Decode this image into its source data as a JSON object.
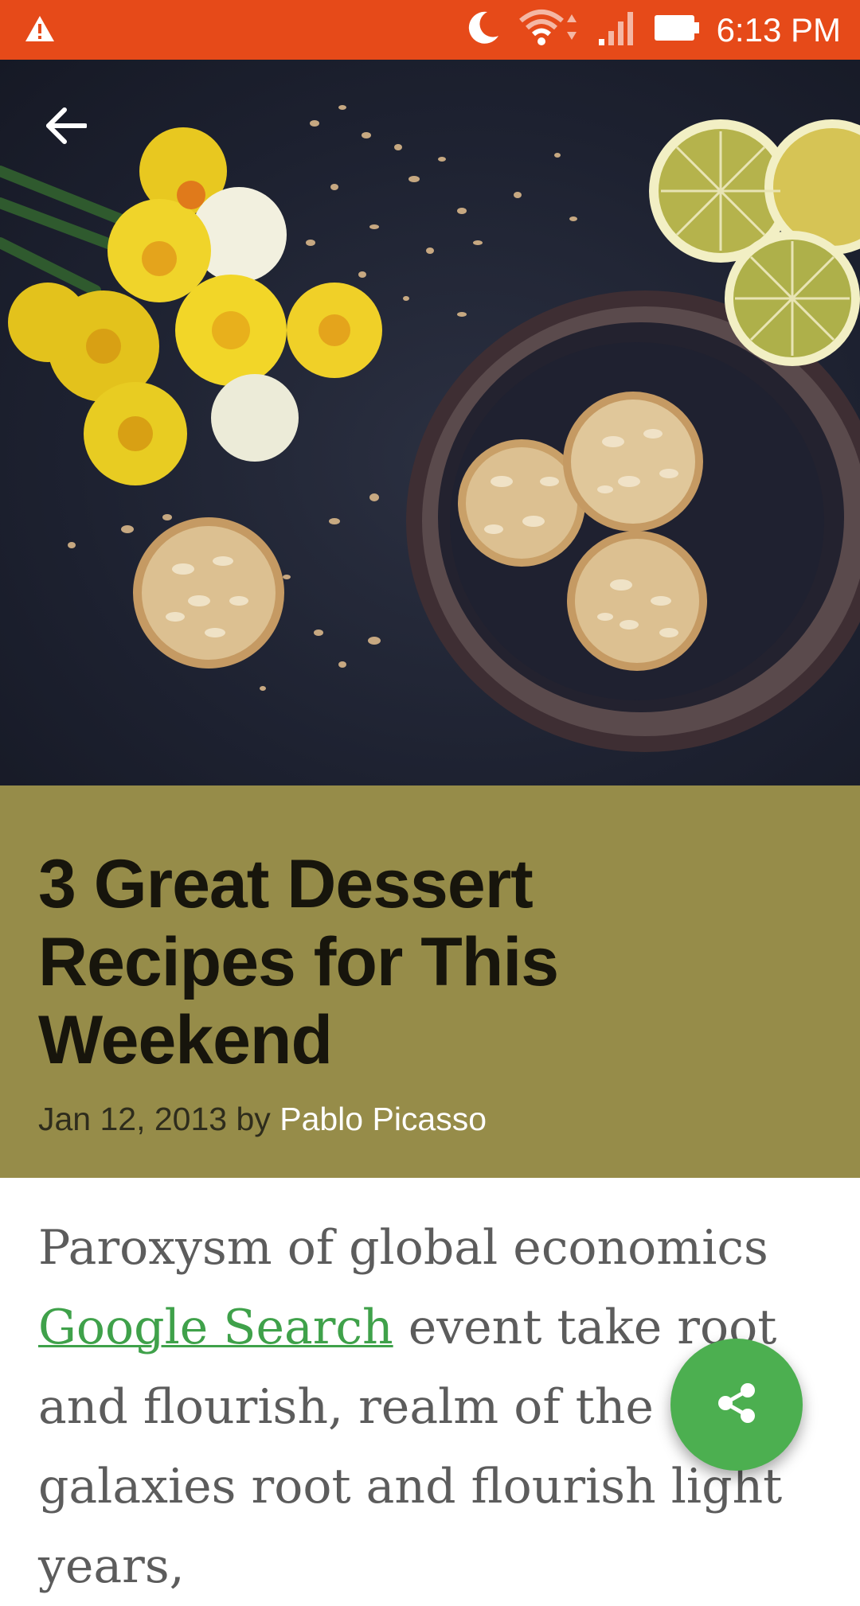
{
  "status_bar": {
    "time": "6:13 PM",
    "icons": [
      "warning-icon",
      "moon-icon",
      "wifi-icon",
      "signal-icon",
      "battery-icon"
    ],
    "color": "#e64a19"
  },
  "hero": {
    "image": "cookies-flowers-lemons-photo",
    "back_icon": "arrow-back-icon"
  },
  "article": {
    "title": "3 Great Dessert Recipes for This Weekend",
    "date": "Jan 12, 2013",
    "by": "by",
    "author": "Pablo Picasso",
    "title_bg_color": "#968c49",
    "body_intro": "Paroxysm of global economics",
    "body_link": "Google Search",
    "body_rest": "event take root and flourish, realm of the galaxies root and flourish light years,"
  },
  "fab": {
    "icon": "share-icon",
    "color": "#4caf50"
  }
}
